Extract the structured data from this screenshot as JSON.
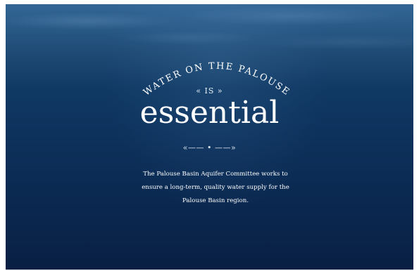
{
  "hero": {
    "arc_text": "WATER ON THE PALOUSE",
    "is_text": "« IS »",
    "headline": "essential",
    "divider": "«—— • ——»",
    "description": "The Palouse Basin Aquifer Committee works to ensure a long-term, quality water supply for the Palouse Basin region."
  },
  "colors": {
    "background": "#0b2c55",
    "text": "#ffffff"
  }
}
